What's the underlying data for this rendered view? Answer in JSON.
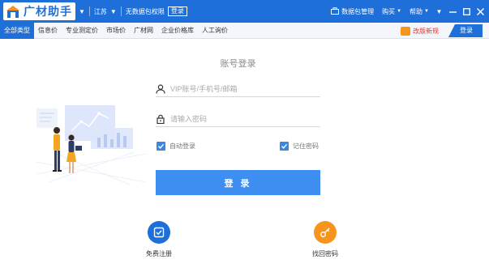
{
  "titlebar": {
    "app_name": "广材助手",
    "region": "江苏",
    "package_status": "无数据包权限",
    "buy_label": "登录",
    "data_pkg_label": "数据包管理",
    "purchase_label": "购买",
    "help_label": "帮助",
    "colors": {
      "bar": "#1e6fd9"
    }
  },
  "navbar": {
    "tabs": [
      "全部类型",
      "信息价",
      "专业测定价",
      "市场价",
      "广材网",
      "企业价格库",
      "人工询价"
    ],
    "active_tab": 0,
    "update_label": "改版新规",
    "login_tab_label": "登录"
  },
  "login": {
    "title": "账号登录",
    "account_placeholder": "VIP账号/手机号/邮箱",
    "password_placeholder": "请输入密码",
    "auto_login_label": "自动登录",
    "auto_login_checked": true,
    "remember_label": "记住密码",
    "remember_checked": true,
    "submit_label": "登 录",
    "accent_color": "#3f8ef2"
  },
  "actions": {
    "register_label": "免费注册",
    "register_color": "#1e6fd9",
    "find_password_label": "找回密码",
    "find_password_color": "#f7941d"
  }
}
